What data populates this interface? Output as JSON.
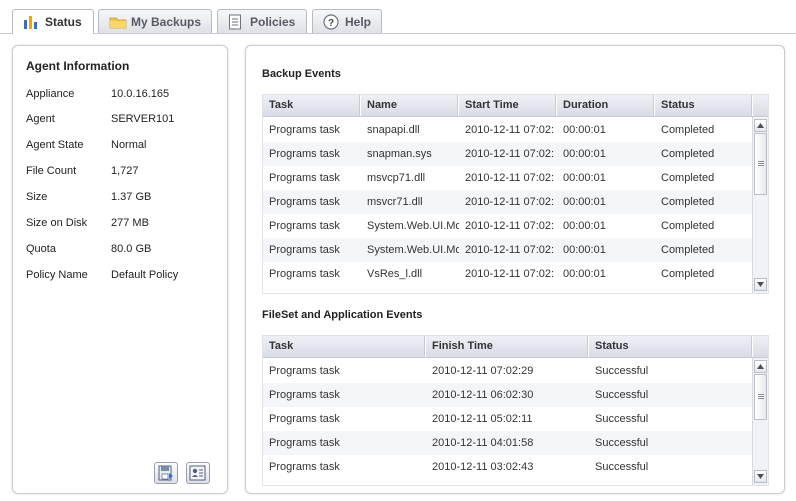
{
  "tabs": [
    {
      "label": "Status",
      "icon": "bar-chart-icon",
      "active": true
    },
    {
      "label": "My Backups",
      "icon": "folder-icon",
      "active": false
    },
    {
      "label": "Policies",
      "icon": "document-icon",
      "active": false
    },
    {
      "label": "Help",
      "icon": "help-icon",
      "active": false
    }
  ],
  "agent": {
    "title": "Agent Information",
    "rows": [
      {
        "label": "Appliance",
        "value": "10.0.16.165"
      },
      {
        "label": "Agent",
        "value": "SERVER101"
      },
      {
        "label": "Agent State",
        "value": "Normal"
      },
      {
        "label": "File Count",
        "value": "1,727"
      },
      {
        "label": "Size",
        "value": "1.37 GB"
      },
      {
        "label": "Size on Disk",
        "value": "277 MB"
      },
      {
        "label": "Quota",
        "value": "80.0 GB"
      },
      {
        "label": "Policy Name",
        "value": "Default Policy"
      }
    ],
    "buttons": [
      "save-report-icon",
      "agent-properties-icon"
    ]
  },
  "backup_events": {
    "title": "Backup Events",
    "columns": [
      "Task",
      "Name",
      "Start Time",
      "Duration",
      "Status"
    ],
    "rows": [
      [
        "Programs task",
        "snapapi.dll",
        "2010-12-11 07:02:",
        "00:00:01",
        "Completed"
      ],
      [
        "Programs task",
        "snapman.sys",
        "2010-12-11 07:02:",
        "00:00:01",
        "Completed"
      ],
      [
        "Programs task",
        "msvcp71.dll",
        "2010-12-11 07:02:",
        "00:00:01",
        "Completed"
      ],
      [
        "Programs task",
        "msvcr71.dll",
        "2010-12-11 07:02:",
        "00:00:01",
        "Completed"
      ],
      [
        "Programs task",
        "System.Web.UI.Mo",
        "2010-12-11 07:02:",
        "00:00:01",
        "Completed"
      ],
      [
        "Programs task",
        "System.Web.UI.Mo",
        "2010-12-11 07:02:",
        "00:00:01",
        "Completed"
      ],
      [
        "Programs task",
        "VsRes_l.dll",
        "2010-12-11 07:02:",
        "00:00:01",
        "Completed"
      ]
    ]
  },
  "fileset_events": {
    "title": "FileSet and Application Events",
    "columns": [
      "Task",
      "Finish Time",
      "Status"
    ],
    "rows": [
      [
        "Programs task",
        "2010-12-11 07:02:29",
        "Successful"
      ],
      [
        "Programs task",
        "2010-12-11 06:02:30",
        "Successful"
      ],
      [
        "Programs task",
        "2010-12-11 05:02:11",
        "Successful"
      ],
      [
        "Programs task",
        "2010-12-11 04:01:58",
        "Successful"
      ],
      [
        "Programs task",
        "2010-12-11 03:02:43",
        "Successful"
      ]
    ]
  },
  "colors": {
    "accent_bar_blue": "#2f6fd0",
    "accent_bar_orange": "#f0a020",
    "folder_yellow": "#f3c54a",
    "help_gray": "#6c7280"
  }
}
